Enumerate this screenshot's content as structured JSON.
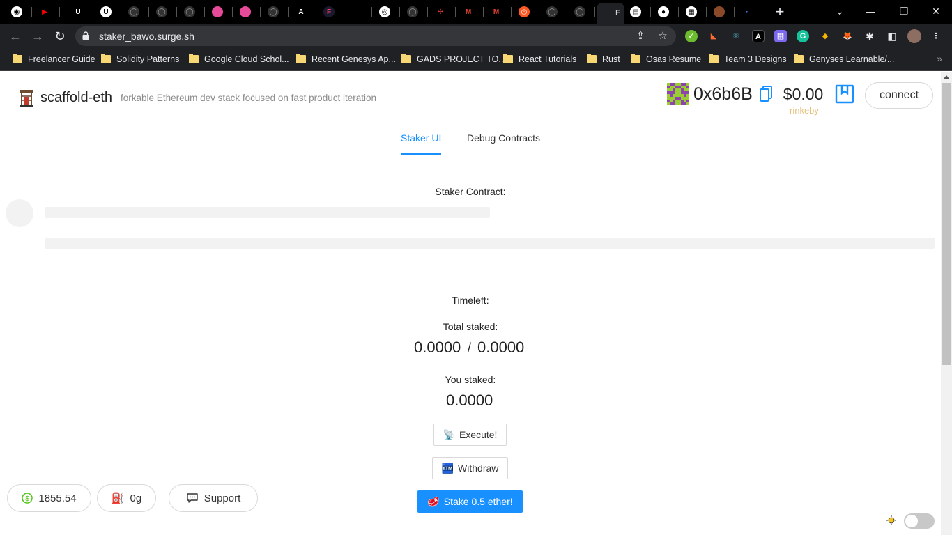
{
  "browser": {
    "tabs": [
      {
        "label": "",
        "color": "#ffffff",
        "glyph": "◉",
        "text_color": "#000000"
      },
      {
        "label": "",
        "color": "#000000",
        "glyph": "▶",
        "text_color": "#ff0000"
      },
      {
        "label": "",
        "color": "#000000",
        "glyph": "U",
        "text_color": "#ffffff"
      },
      {
        "label": "",
        "color": "#ffffff",
        "glyph": "U",
        "text_color": "#000000"
      },
      {
        "label": "",
        "color": "#333333",
        "glyph": "◯",
        "text_color": "#999999"
      },
      {
        "label": "",
        "color": "#333333",
        "glyph": "◯",
        "text_color": "#999999"
      },
      {
        "label": "",
        "color": "#333333",
        "glyph": "◯",
        "text_color": "#999999"
      },
      {
        "label": "",
        "color": "#e84a9a",
        "glyph": "",
        "text_color": "#ffffff"
      },
      {
        "label": "",
        "color": "#e84a9a",
        "glyph": "",
        "text_color": "#ffffff"
      },
      {
        "label": "",
        "color": "#333333",
        "glyph": "◯",
        "text_color": "#999999"
      },
      {
        "label": "",
        "color": "#000000",
        "glyph": "A",
        "text_color": "#ffffff"
      },
      {
        "label": "",
        "color": "#1a1a2e",
        "glyph": "F",
        "text_color": "#ff3366"
      },
      {
        "label": "",
        "color": "#000000",
        "glyph": "",
        "text_color": "#ffffff"
      },
      {
        "label": "",
        "color": "#ffffff",
        "glyph": "◎",
        "text_color": "#000000"
      },
      {
        "label": "",
        "color": "#333333",
        "glyph": "◯",
        "text_color": "#999999"
      },
      {
        "label": "",
        "color": "#000000",
        "glyph": "✢",
        "text_color": "#e53935"
      },
      {
        "label": "",
        "color": "#000000",
        "glyph": "M",
        "text_color": "#ea4335"
      },
      {
        "label": "",
        "color": "#000000",
        "glyph": "M",
        "text_color": "#ea4335"
      },
      {
        "label": "",
        "color": "#ff5722",
        "glyph": "◎",
        "text_color": "#ffffff"
      },
      {
        "label": "",
        "color": "#333333",
        "glyph": "◯",
        "text_color": "#999999"
      },
      {
        "label": "",
        "color": "#333333",
        "glyph": "◯",
        "text_color": "#999999"
      },
      {
        "label": "E",
        "color": "#202124",
        "glyph": "",
        "text_color": "#e8eaed"
      },
      {
        "label": "",
        "color": "#ffffff",
        "glyph": "▤",
        "text_color": "#555555"
      },
      {
        "label": "",
        "color": "#ffffff",
        "glyph": "●",
        "text_color": "#000000"
      },
      {
        "label": "",
        "color": "#ffffff",
        "glyph": "▦",
        "text_color": "#000000"
      },
      {
        "label": "",
        "color": "#8a4a2a",
        "glyph": "",
        "text_color": "#ffffff"
      },
      {
        "label": "",
        "color": "#000000",
        "glyph": "·",
        "text_color": "#4285f4"
      }
    ],
    "url": "staker_bawo.surge.sh",
    "bookmarks": [
      {
        "label": "Freelancer Guide"
      },
      {
        "label": "Solidity Patterns"
      },
      {
        "label": "Google Cloud Schol..."
      },
      {
        "label": "Recent Genesys Ap..."
      },
      {
        "label": "GADS PROJECT TO..."
      },
      {
        "label": "React Tutorials"
      },
      {
        "label": "Rust"
      },
      {
        "label": "Osas Resume"
      },
      {
        "label": "Team 3 Designs"
      },
      {
        "label": "Genyses Learnable/..."
      }
    ]
  },
  "header": {
    "title": "scaffold-eth",
    "subtitle": "forkable Ethereum dev stack focused on fast product iteration",
    "address": "0x6b6B",
    "balance": "$0.00",
    "network": "rinkeby",
    "connect_label": "connect"
  },
  "nav": {
    "tabs": [
      {
        "label": "Staker UI"
      },
      {
        "label": "Debug Contracts"
      }
    ]
  },
  "main": {
    "contract_label": "Staker Contract:",
    "timeleft_label": "Timeleft:",
    "total_staked_label": "Total staked:",
    "total_staked_value": "0.0000",
    "total_staked_sep": "/",
    "threshold_value": "0.0000",
    "you_staked_label": "You staked:",
    "you_staked_value": "0.0000",
    "execute_label": "Execute!",
    "withdraw_label": "Withdraw",
    "stake_label": "Stake 0.5 ether!"
  },
  "footer": {
    "price": "1855.54",
    "gas": "0g",
    "support_label": "Support"
  },
  "colors": {
    "accent": "#1890ff",
    "network": "#e5c07b",
    "blockie_a": "#9acd32",
    "blockie_b": "#8e44ad"
  }
}
